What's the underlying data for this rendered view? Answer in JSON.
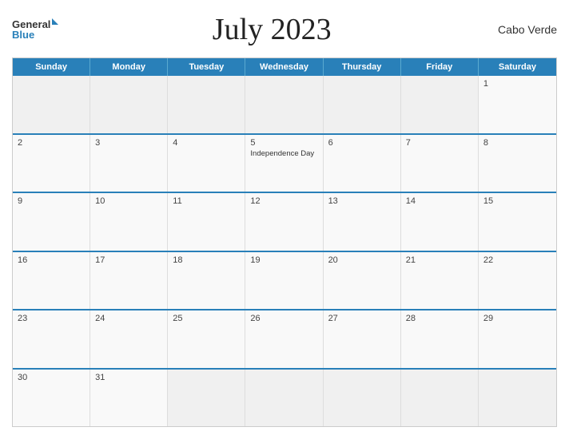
{
  "header": {
    "logo_general": "General",
    "logo_blue": "Blue",
    "title": "July 2023",
    "country": "Cabo Verde"
  },
  "days_of_week": [
    "Sunday",
    "Monday",
    "Tuesday",
    "Wednesday",
    "Thursday",
    "Friday",
    "Saturday"
  ],
  "weeks": [
    [
      {
        "day": "",
        "empty": true
      },
      {
        "day": "",
        "empty": true
      },
      {
        "day": "",
        "empty": true
      },
      {
        "day": "",
        "empty": true
      },
      {
        "day": "",
        "empty": true
      },
      {
        "day": "",
        "empty": true
      },
      {
        "day": "1",
        "empty": false,
        "event": ""
      }
    ],
    [
      {
        "day": "2",
        "empty": false,
        "event": ""
      },
      {
        "day": "3",
        "empty": false,
        "event": ""
      },
      {
        "day": "4",
        "empty": false,
        "event": ""
      },
      {
        "day": "5",
        "empty": false,
        "event": "Independence Day"
      },
      {
        "day": "6",
        "empty": false,
        "event": ""
      },
      {
        "day": "7",
        "empty": false,
        "event": ""
      },
      {
        "day": "8",
        "empty": false,
        "event": ""
      }
    ],
    [
      {
        "day": "9",
        "empty": false,
        "event": ""
      },
      {
        "day": "10",
        "empty": false,
        "event": ""
      },
      {
        "day": "11",
        "empty": false,
        "event": ""
      },
      {
        "day": "12",
        "empty": false,
        "event": ""
      },
      {
        "day": "13",
        "empty": false,
        "event": ""
      },
      {
        "day": "14",
        "empty": false,
        "event": ""
      },
      {
        "day": "15",
        "empty": false,
        "event": ""
      }
    ],
    [
      {
        "day": "16",
        "empty": false,
        "event": ""
      },
      {
        "day": "17",
        "empty": false,
        "event": ""
      },
      {
        "day": "18",
        "empty": false,
        "event": ""
      },
      {
        "day": "19",
        "empty": false,
        "event": ""
      },
      {
        "day": "20",
        "empty": false,
        "event": ""
      },
      {
        "day": "21",
        "empty": false,
        "event": ""
      },
      {
        "day": "22",
        "empty": false,
        "event": ""
      }
    ],
    [
      {
        "day": "23",
        "empty": false,
        "event": ""
      },
      {
        "day": "24",
        "empty": false,
        "event": ""
      },
      {
        "day": "25",
        "empty": false,
        "event": ""
      },
      {
        "day": "26",
        "empty": false,
        "event": ""
      },
      {
        "day": "27",
        "empty": false,
        "event": ""
      },
      {
        "day": "28",
        "empty": false,
        "event": ""
      },
      {
        "day": "29",
        "empty": false,
        "event": ""
      }
    ],
    [
      {
        "day": "30",
        "empty": false,
        "event": ""
      },
      {
        "day": "31",
        "empty": false,
        "event": ""
      },
      {
        "day": "",
        "empty": true
      },
      {
        "day": "",
        "empty": true
      },
      {
        "day": "",
        "empty": true
      },
      {
        "day": "",
        "empty": true
      },
      {
        "day": "",
        "empty": true
      }
    ]
  ]
}
